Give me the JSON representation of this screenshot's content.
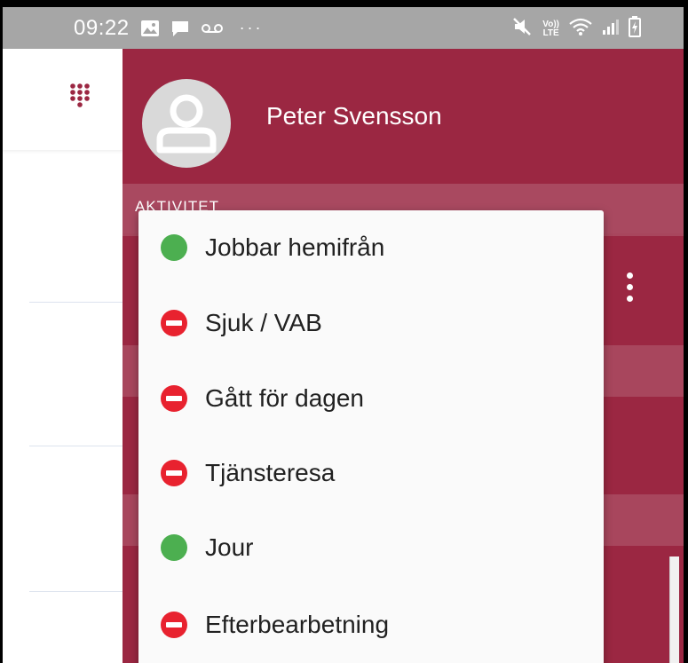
{
  "status_bar": {
    "time": "09:22",
    "lte_top": "Vo))",
    "lte_bottom": "LTE",
    "left_icons": [
      "image-icon",
      "chat-icon",
      "voicemail-icon"
    ],
    "right_icons": [
      "mute-icon",
      "volte-icon",
      "wifi-icon",
      "signal-icon",
      "battery-icon"
    ]
  },
  "drawer": {
    "user_name": "Peter Svensson",
    "section_label": "AKTIVITET"
  },
  "menu": {
    "items": [
      {
        "label": "Jobbar hemifrån",
        "status": "available"
      },
      {
        "label": "Sjuk / VAB",
        "status": "busy"
      },
      {
        "label": "Gått för dagen",
        "status": "busy"
      },
      {
        "label": "Tjänsteresa",
        "status": "busy"
      },
      {
        "label": "Jour",
        "status": "available"
      },
      {
        "label": "Efterbearbetning",
        "status": "busy"
      }
    ]
  },
  "colors": {
    "brand": "#9b2742",
    "available": "#4caf50",
    "busy": "#e8222f",
    "status_bar": "#a6a6a6"
  }
}
